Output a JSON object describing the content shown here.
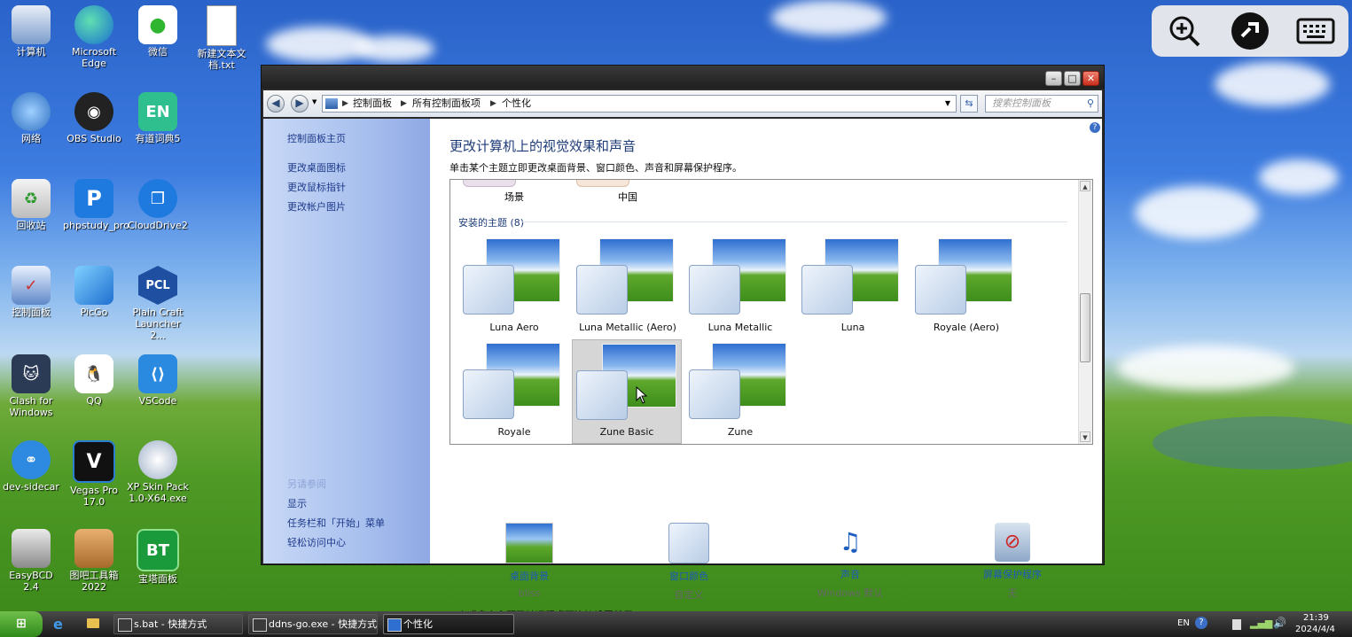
{
  "desktop": {
    "icons": [
      {
        "label": "计算机",
        "icon": "computer-icon"
      },
      {
        "label": "Microsoft Edge",
        "icon": "edge-icon"
      },
      {
        "label": "微信",
        "icon": "wechat-icon"
      },
      {
        "label": "新建文本文档.txt",
        "icon": "text-file-icon"
      },
      {
        "label": "网络",
        "icon": "network-icon"
      },
      {
        "label": "OBS Studio",
        "icon": "obs-icon"
      },
      {
        "label": "有道词典5",
        "icon": "dictionary-icon",
        "badge": "EN"
      },
      {
        "label": "回收站",
        "icon": "recycle-bin-icon"
      },
      {
        "label": "phpstudy_pro",
        "icon": "phpstudy-icon",
        "badge": "P"
      },
      {
        "label": "CloudDrive2",
        "icon": "clouddrive-icon"
      },
      {
        "label": "控制面板",
        "icon": "control-panel-icon"
      },
      {
        "label": "PicGo",
        "icon": "picgo-icon"
      },
      {
        "label": "Plain Craft Launcher 2...",
        "icon": "pcl-icon",
        "badge": "PCL"
      },
      {
        "label": "Clash for Windows",
        "icon": "clash-icon"
      },
      {
        "label": "QQ",
        "icon": "qq-icon"
      },
      {
        "label": "VSCode",
        "icon": "vscode-icon"
      },
      {
        "label": "dev-sidecar",
        "icon": "dev-sidecar-icon"
      },
      {
        "label": "Vegas Pro 17.0",
        "icon": "vegas-icon",
        "badge": "V"
      },
      {
        "label": "XP Skin Pack 1.0-X64.exe",
        "icon": "skin-pack-icon"
      },
      {
        "label": "EasyBCD 2.4",
        "icon": "easybcd-icon"
      },
      {
        "label": "图吧工具箱 2022",
        "icon": "toolbox-icon"
      },
      {
        "label": "宝塔面板",
        "icon": "bt-panel-icon",
        "badge": "BT"
      }
    ]
  },
  "window": {
    "breadcrumb": [
      "控制面板",
      "所有控制面板项",
      "个性化"
    ],
    "search_placeholder": "搜索控制面板",
    "sidebar": {
      "home": "控制面板主页",
      "links": [
        "更改桌面图标",
        "更改鼠标指针",
        "更改帐户图片"
      ],
      "see_also": "另请参阅",
      "bottom_links": [
        "显示",
        "任务栏和「开始」菜单",
        "轻松访问中心"
      ]
    },
    "title": "更改计算机上的视觉效果和声音",
    "subtitle": "单击某个主题立即更改桌面背景、窗口颜色、声音和屏幕保护程序。",
    "partial_themes": [
      "场景",
      "中国"
    ],
    "installed_group": "安装的主题 (8)",
    "themes": [
      {
        "name": "Luna Aero",
        "selected": false
      },
      {
        "name": "Luna Metallic (Aero)",
        "selected": false
      },
      {
        "name": "Luna Metallic",
        "selected": false
      },
      {
        "name": "Luna",
        "selected": false
      },
      {
        "name": "Royale (Aero)",
        "selected": false
      },
      {
        "name": "Royale",
        "selected": false
      },
      {
        "name": "Zune Basic",
        "selected": true
      },
      {
        "name": "Zune",
        "selected": false
      }
    ],
    "bottom": [
      {
        "label": "桌面背景",
        "value": "bliss",
        "icon": "desktop-background-icon"
      },
      {
        "label": "窗口颜色",
        "value": "自定义",
        "icon": "window-color-icon"
      },
      {
        "label": "声音",
        "value": "Windows 默认",
        "icon": "sound-icon"
      },
      {
        "label": "屏幕保护程序",
        "value": "无",
        "icon": "screensaver-icon"
      }
    ],
    "footnote": "一个或多个主题已被远程桌面连接设置禁用。"
  },
  "taskbar": {
    "tasks": [
      {
        "label": "s.bat - 快捷方式"
      },
      {
        "label": "ddns-go.exe - 快捷方式"
      },
      {
        "label": "个性化"
      }
    ],
    "lang": "EN",
    "time": "21:39",
    "date": "2024/4/4"
  },
  "colors": {
    "link": "#1e5bb8",
    "title": "#1e3c78",
    "sidebar": "#a8c0ee"
  }
}
